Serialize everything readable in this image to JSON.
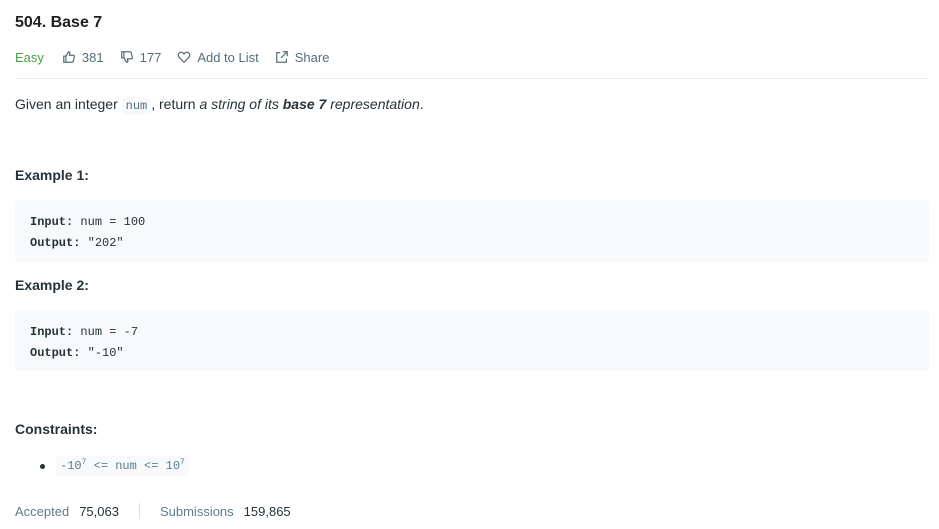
{
  "problem": {
    "title": "504. Base 7",
    "difficulty": "Easy",
    "likes": "381",
    "dislikes": "177",
    "add_to_list": "Add to List",
    "share": "Share"
  },
  "description": {
    "prefix": "Given an integer ",
    "code": "num",
    "middle": ", return ",
    "italic1": "a string of its ",
    "bold": "base 7",
    "italic2": " representation",
    "suffix": "."
  },
  "examples": [
    {
      "title": "Example 1:",
      "input_label": "Input:",
      "input_value": " num = 100",
      "output_label": "Output:",
      "output_value": " \"202\""
    },
    {
      "title": "Example 2:",
      "input_label": "Input:",
      "input_value": " num = -7",
      "output_label": "Output:",
      "output_value": " \"-10\""
    }
  ],
  "constraints": {
    "title": "Constraints:",
    "items": [
      {
        "part1": "-10",
        "sup1": "7",
        "part2": " <= num <= 10",
        "sup2": "7"
      }
    ]
  },
  "stats": {
    "accepted_label": "Accepted",
    "accepted_value": "75,063",
    "submissions_label": "Submissions",
    "submissions_value": "159,865"
  },
  "colors": {
    "difficulty_easy": "#43a047",
    "code_background": "#f7f9fa",
    "muted_text": "#546e7a"
  },
  "icons": {
    "like": "thumbs-up-icon",
    "dislike": "thumbs-down-icon",
    "add_to_list": "heart-icon",
    "share": "share-icon"
  }
}
